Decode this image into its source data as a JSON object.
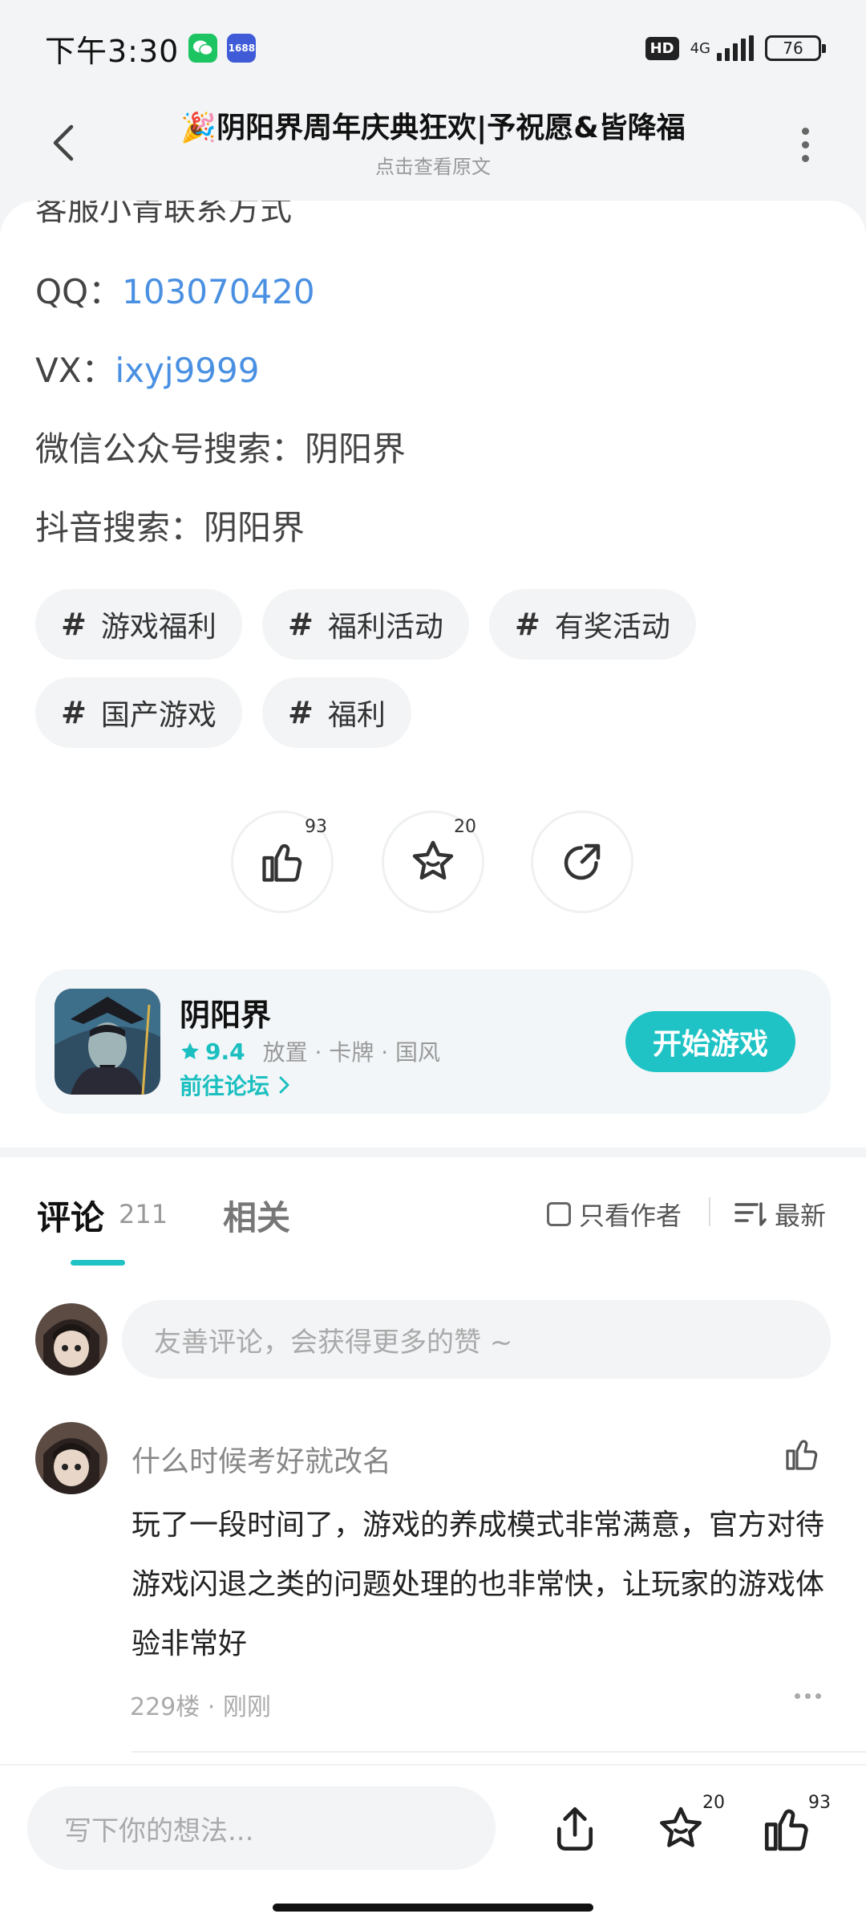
{
  "status_bar": {
    "time": "下午3:30",
    "app_badge": "1688",
    "hd": "HD",
    "network": "4G",
    "battery": "76"
  },
  "title_bar": {
    "emoji": "🎉",
    "title": "阴阳界周年庆典狂欢|予祝愿&皆降福",
    "subtitle": "点击查看原文"
  },
  "article": {
    "cut_line": "客服小青联系方式",
    "qq_label": "QQ：",
    "qq_value": "103070420",
    "vx_label": "VX：",
    "vx_value": "ixyj9999",
    "wechat": "微信公众号搜索：阴阳界",
    "douyin": "抖音搜索：阴阳界",
    "tags": [
      "游戏福利",
      "福利活动",
      "有奖活动",
      "国产游戏",
      "福利"
    ],
    "hash": "#"
  },
  "actions": {
    "like_count": "93",
    "favorite_count": "20"
  },
  "game": {
    "name": "阴阳界",
    "score": "9.4",
    "genres": "放置 · 卡牌 · 国风",
    "forum_link": "前往论坛",
    "start_button": "开始游戏",
    "accent": "#1fc3c5"
  },
  "comments": {
    "tab_comments": "评论",
    "comment_count": "211",
    "tab_related": "相关",
    "author_only": "只看作者",
    "sort_label": "最新",
    "input_placeholder": "友善评论，会获得更多的赞 ~",
    "items": [
      {
        "author": "什么时候考好就改名",
        "body": "玩了一段时间了，游戏的养成模式非常满意，官方对待游戏闪退之类的问题处理的也非常快，让玩家的游戏体验非常好",
        "meta": "229楼 · 刚刚"
      }
    ]
  },
  "bottom_bar": {
    "placeholder": "写下你的想法...",
    "favorite_count": "20",
    "like_count": "93"
  }
}
